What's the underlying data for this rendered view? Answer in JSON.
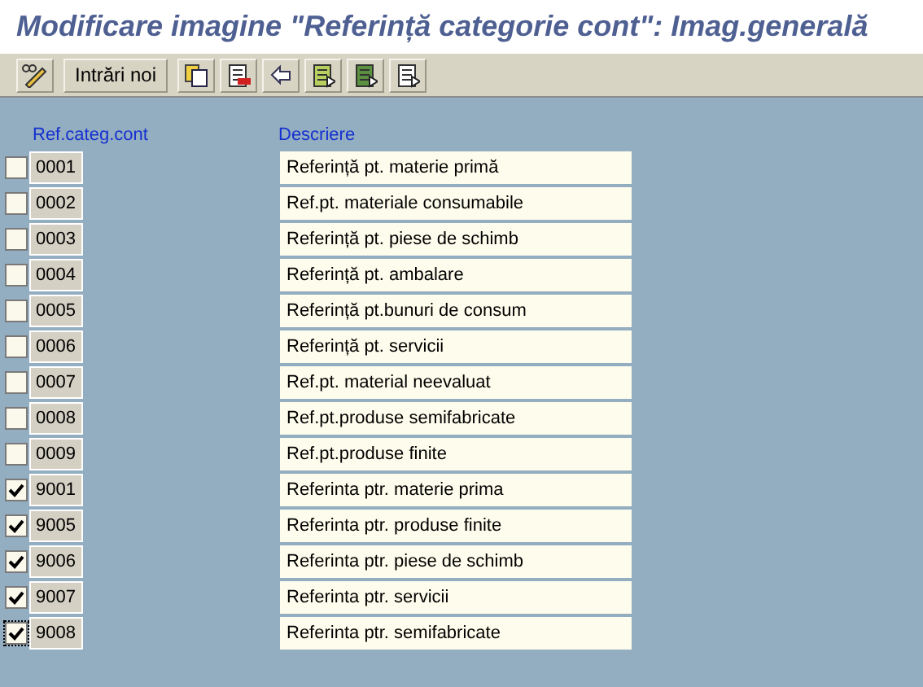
{
  "title": "Modificare imagine \"Referință categorie cont\": Imag.generală",
  "toolbar": {
    "button": "Intrări noi"
  },
  "table": {
    "columns": [
      "Ref.categ.cont",
      "Descriere"
    ],
    "rows": [
      {
        "code": "0001",
        "description": "Referință pt. materie primă",
        "checked": false,
        "focused": false
      },
      {
        "code": "0002",
        "description": "Ref.pt. materiale consumabile",
        "checked": false,
        "focused": false
      },
      {
        "code": "0003",
        "description": "Referință pt. piese de schimb",
        "checked": false,
        "focused": false
      },
      {
        "code": "0004",
        "description": "Referință pt. ambalare",
        "checked": false,
        "focused": false
      },
      {
        "code": "0005",
        "description": "Referință pt.bunuri de consum",
        "checked": false,
        "focused": false
      },
      {
        "code": "0006",
        "description": "Referință pt. servicii",
        "checked": false,
        "focused": false
      },
      {
        "code": "0007",
        "description": "Ref.pt. material neevaluat",
        "checked": false,
        "focused": false
      },
      {
        "code": "0008",
        "description": "Ref.pt.produse semifabricate",
        "checked": false,
        "focused": false
      },
      {
        "code": "0009",
        "description": "Ref.pt.produse finite",
        "checked": false,
        "focused": false
      },
      {
        "code": "9001",
        "description": "Referinta ptr. materie prima",
        "checked": true,
        "focused": false
      },
      {
        "code": "9005",
        "description": "Referinta ptr. produse finite",
        "checked": true,
        "focused": false
      },
      {
        "code": "9006",
        "description": "Referinta ptr. piese de schimb",
        "checked": true,
        "focused": false
      },
      {
        "code": "9007",
        "description": "Referinta ptr. servicii",
        "checked": true,
        "focused": false
      },
      {
        "code": "9008",
        "description": "Referinta ptr. semifabricate",
        "checked": true,
        "focused": true
      }
    ]
  }
}
